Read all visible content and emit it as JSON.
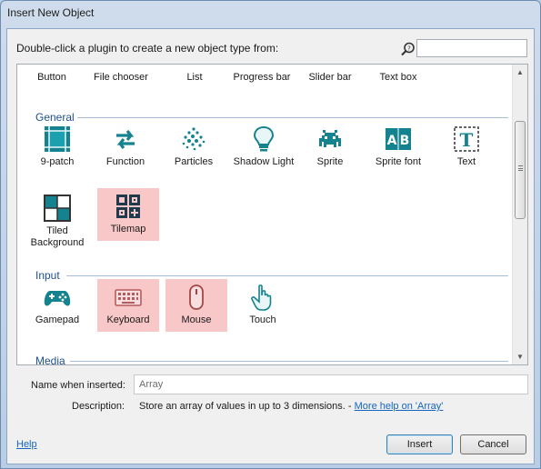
{
  "window": {
    "title": "Insert New Object"
  },
  "header": {
    "instruction": "Double-click a plugin to create a new object type from:",
    "search_icon": "search-icon",
    "search_value": ""
  },
  "list": {
    "top_row": [
      "Button",
      "File chooser",
      "List",
      "Progress bar",
      "Slider bar",
      "Text box"
    ],
    "categories": [
      {
        "name": "General",
        "items": [
          {
            "label": "9-patch",
            "icon": "nine-patch-icon",
            "highlighted": false
          },
          {
            "label": "Function",
            "icon": "function-icon",
            "highlighted": false
          },
          {
            "label": "Particles",
            "icon": "particles-icon",
            "highlighted": false
          },
          {
            "label": "Shadow Light",
            "icon": "shadow-light-icon",
            "highlighted": false
          },
          {
            "label": "Sprite",
            "icon": "sprite-icon",
            "highlighted": false
          },
          {
            "label": "Sprite font",
            "icon": "sprite-font-icon",
            "highlighted": false
          },
          {
            "label": "Text",
            "icon": "text-icon",
            "highlighted": false
          },
          {
            "label": "Tiled Background",
            "icon": "tiled-background-icon",
            "highlighted": false
          },
          {
            "label": "Tilemap",
            "icon": "tilemap-icon",
            "highlighted": true
          }
        ]
      },
      {
        "name": "Input",
        "items": [
          {
            "label": "Gamepad",
            "icon": "gamepad-icon",
            "highlighted": false
          },
          {
            "label": "Keyboard",
            "icon": "keyboard-icon",
            "highlighted": true
          },
          {
            "label": "Mouse",
            "icon": "mouse-icon",
            "highlighted": true
          },
          {
            "label": "Touch",
            "icon": "touch-icon",
            "highlighted": false
          }
        ]
      },
      {
        "name": "Media",
        "items": []
      }
    ]
  },
  "form": {
    "name_label": "Name when inserted:",
    "name_value": "Array",
    "description_label": "Description:",
    "description_text": "Store an array of values in up to 3 dimensions. - ",
    "description_link": "More help on 'Array'"
  },
  "footer": {
    "help_label": "Help",
    "insert_label": "Insert",
    "cancel_label": "Cancel"
  },
  "colors": {
    "accent": "#1f4f8e",
    "icon_teal": "#14838f",
    "highlight": "#f8c7c7",
    "link": "#1565c0"
  }
}
